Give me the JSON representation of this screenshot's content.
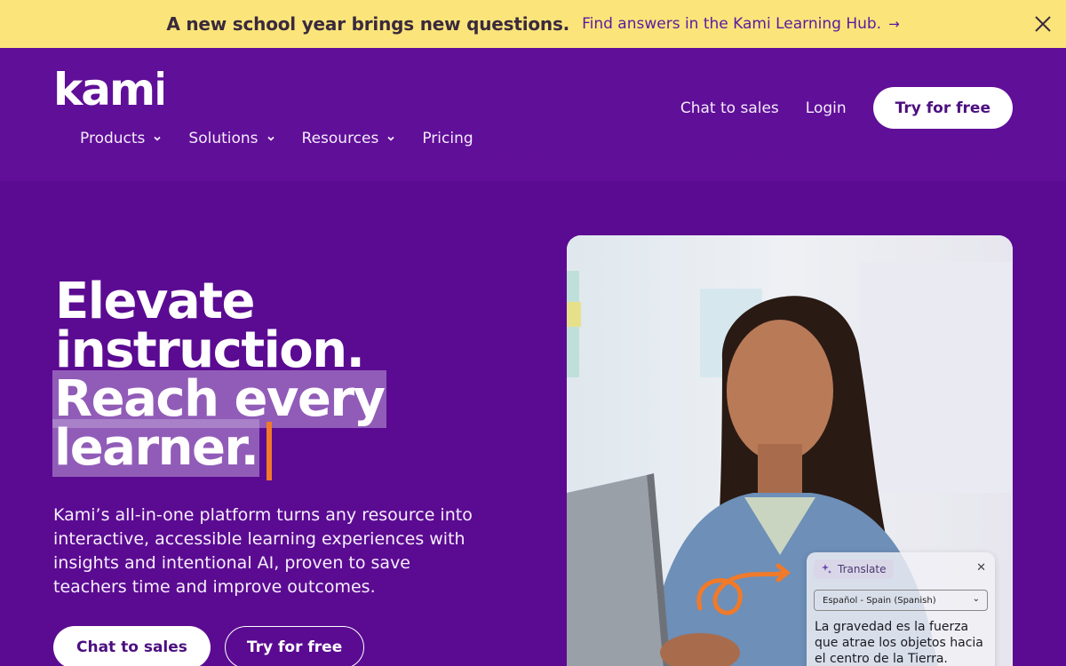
{
  "banner": {
    "headline": "A new school year brings new questions.",
    "link_label": "Find answers in the Kami Learning Hub.",
    "arrow_glyph": "→"
  },
  "logo": {
    "text": "kami"
  },
  "nav": {
    "items": [
      {
        "label": "Products",
        "dropdown": true
      },
      {
        "label": "Solutions",
        "dropdown": true
      },
      {
        "label": "Resources",
        "dropdown": true
      },
      {
        "label": "Pricing",
        "dropdown": false
      }
    ]
  },
  "header": {
    "chat_label": "Chat to sales",
    "login_label": "Login",
    "try_label": "Try for free"
  },
  "hero": {
    "title_line1": "Elevate",
    "title_line2": "instruction.",
    "title_line3": "Reach every",
    "title_line4": "learner.",
    "description": "Kami’s all-in-one platform turns any resource into interactive, accessible learning experiences with insights and intentional AI, proven to save teachers time and improve outcomes.",
    "chat_button": "Chat to sales",
    "try_button": "Try for free"
  },
  "translate_card": {
    "chip_label": "Translate",
    "select_value": "Español - Spain (Spanish)",
    "translated_text": "La gravedad es la fuerza que atrae los objetos hacia el centro de la Tierra."
  },
  "colors": {
    "background": "#5b0b92",
    "banner": "#fbe57a",
    "accent_orange": "#f07a2a",
    "button_text": "#4c0f80"
  },
  "icons": [
    "close-icon",
    "chevron-down-icon",
    "arrow-right-icon",
    "translate-sparkle-icon"
  ]
}
